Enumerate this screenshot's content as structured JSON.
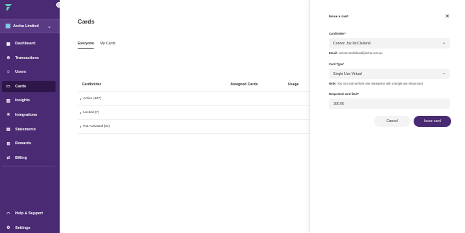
{
  "sidebar": {
    "org_name": "Archa Limited",
    "items": [
      {
        "label": "Dashboard",
        "icon": "grid-icon"
      },
      {
        "label": "Transactions",
        "icon": "dollar-icon"
      },
      {
        "label": "Users",
        "icon": "users-icon"
      },
      {
        "label": "Cards",
        "icon": "card-icon",
        "active": true
      },
      {
        "label": "Insights",
        "icon": "bar-chart-icon"
      },
      {
        "label": "Integrations",
        "icon": "star-icon"
      },
      {
        "label": "Statements",
        "icon": "document-icon"
      },
      {
        "label": "Rewards",
        "icon": "gift-icon"
      },
      {
        "label": "Billing",
        "icon": "arrows-icon"
      }
    ],
    "bottom_items": [
      {
        "label": "Help & Support",
        "icon": "headset-icon"
      },
      {
        "label": "Settings",
        "icon": "gear-icon"
      }
    ]
  },
  "main": {
    "title": "Cards",
    "tabs": [
      {
        "label": "Everyone",
        "active": true
      },
      {
        "label": "My Cards",
        "active": false
      }
    ],
    "columns": {
      "cardholder": "Cardholder",
      "assigned": "Assigned Cards",
      "usage": "Usage"
    },
    "groups": [
      {
        "label": "Active (107)"
      },
      {
        "label": "Locked (7)"
      },
      {
        "label": "Not Activated (31)"
      }
    ]
  },
  "panel": {
    "title": "Issue a card",
    "cardholder_label": "Cardholder*",
    "cardholder_value": "Connor Joy McClelland",
    "email_label": "Email:",
    "email_value": "connor.mcclelland@archa.com.au",
    "card_type_label": "Card Type*",
    "card_type_value": "Single Use Virtual",
    "note_label": "Note:",
    "note_text": "You can only perform one transaction with a single-use virtual card.",
    "limit_label": "Requested card limit*",
    "limit_value": "100.00",
    "cancel_label": "Cancel",
    "issue_label": "Issue card"
  },
  "colors": {
    "sidebar": "#4a2a72",
    "active_nav": "#2d1648",
    "primary_button": "#4a2a72"
  }
}
